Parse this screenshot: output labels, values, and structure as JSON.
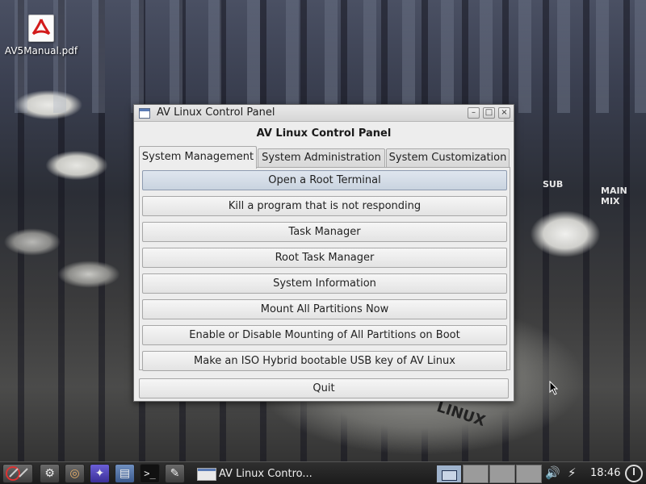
{
  "desktop": {
    "icons": [
      {
        "label": "AV5Manual.pdf",
        "icon": "pdf-document-icon"
      }
    ],
    "background_labels": [
      "SUB",
      "MAIN MIX",
      "LINUX"
    ]
  },
  "window": {
    "title": "AV Linux Control Panel",
    "controls": {
      "minimize": "–",
      "maximize": "□",
      "close": "×"
    },
    "heading": "AV Linux Control Panel",
    "tabs": [
      {
        "label": "System Management",
        "active": true
      },
      {
        "label": "System Administration",
        "active": false
      },
      {
        "label": "System Customization",
        "active": false
      }
    ],
    "actions": [
      {
        "label": "Open a Root Terminal",
        "highlighted": true
      },
      {
        "label": "Kill a program that is not responding",
        "highlighted": false
      },
      {
        "label": "Task Manager",
        "highlighted": false
      },
      {
        "label": "Root Task Manager",
        "highlighted": false
      },
      {
        "label": "System Information",
        "highlighted": false
      },
      {
        "label": "Mount All Partitions Now",
        "highlighted": false
      },
      {
        "label": "Enable or Disable Mounting of All Partitions on Boot",
        "highlighted": false
      },
      {
        "label": "Make an ISO Hybrid bootable USB key of AV Linux",
        "highlighted": false
      }
    ],
    "quit_label": "Quit"
  },
  "taskbar": {
    "launchers": [
      "av-linux-menu-icon",
      "settings-icon",
      "file-manager-icon",
      "app-icon",
      "desktop-icon",
      "terminal-icon",
      "editor-icon"
    ],
    "task_label": "AV Linux Contro...",
    "pager": [
      "desktop-1",
      "desktop-2",
      "desktop-3",
      "desktop-4"
    ],
    "active_desktop": 1,
    "clock": "18:46",
    "tray": [
      "volume-icon",
      "network-icon",
      "power-icon"
    ]
  },
  "colors": {
    "window_bg": "#ededed",
    "highlight": "#c9d3df",
    "taskbar": "#1b1b1b"
  }
}
